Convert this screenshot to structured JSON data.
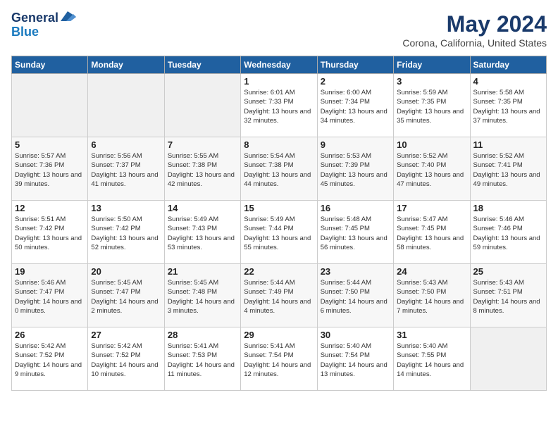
{
  "header": {
    "logo_line1": "General",
    "logo_line2": "Blue",
    "title": "May 2024",
    "subtitle": "Corona, California, United States"
  },
  "days_of_week": [
    "Sunday",
    "Monday",
    "Tuesday",
    "Wednesday",
    "Thursday",
    "Friday",
    "Saturday"
  ],
  "weeks": [
    [
      {
        "day": "",
        "empty": true
      },
      {
        "day": "",
        "empty": true
      },
      {
        "day": "",
        "empty": true
      },
      {
        "day": "1",
        "sunrise": "Sunrise: 6:01 AM",
        "sunset": "Sunset: 7:33 PM",
        "daylight": "Daylight: 13 hours and 32 minutes."
      },
      {
        "day": "2",
        "sunrise": "Sunrise: 6:00 AM",
        "sunset": "Sunset: 7:34 PM",
        "daylight": "Daylight: 13 hours and 34 minutes."
      },
      {
        "day": "3",
        "sunrise": "Sunrise: 5:59 AM",
        "sunset": "Sunset: 7:35 PM",
        "daylight": "Daylight: 13 hours and 35 minutes."
      },
      {
        "day": "4",
        "sunrise": "Sunrise: 5:58 AM",
        "sunset": "Sunset: 7:35 PM",
        "daylight": "Daylight: 13 hours and 37 minutes."
      }
    ],
    [
      {
        "day": "5",
        "sunrise": "Sunrise: 5:57 AM",
        "sunset": "Sunset: 7:36 PM",
        "daylight": "Daylight: 13 hours and 39 minutes."
      },
      {
        "day": "6",
        "sunrise": "Sunrise: 5:56 AM",
        "sunset": "Sunset: 7:37 PM",
        "daylight": "Daylight: 13 hours and 41 minutes."
      },
      {
        "day": "7",
        "sunrise": "Sunrise: 5:55 AM",
        "sunset": "Sunset: 7:38 PM",
        "daylight": "Daylight: 13 hours and 42 minutes."
      },
      {
        "day": "8",
        "sunrise": "Sunrise: 5:54 AM",
        "sunset": "Sunset: 7:38 PM",
        "daylight": "Daylight: 13 hours and 44 minutes."
      },
      {
        "day": "9",
        "sunrise": "Sunrise: 5:53 AM",
        "sunset": "Sunset: 7:39 PM",
        "daylight": "Daylight: 13 hours and 45 minutes."
      },
      {
        "day": "10",
        "sunrise": "Sunrise: 5:52 AM",
        "sunset": "Sunset: 7:40 PM",
        "daylight": "Daylight: 13 hours and 47 minutes."
      },
      {
        "day": "11",
        "sunrise": "Sunrise: 5:52 AM",
        "sunset": "Sunset: 7:41 PM",
        "daylight": "Daylight: 13 hours and 49 minutes."
      }
    ],
    [
      {
        "day": "12",
        "sunrise": "Sunrise: 5:51 AM",
        "sunset": "Sunset: 7:42 PM",
        "daylight": "Daylight: 13 hours and 50 minutes."
      },
      {
        "day": "13",
        "sunrise": "Sunrise: 5:50 AM",
        "sunset": "Sunset: 7:42 PM",
        "daylight": "Daylight: 13 hours and 52 minutes."
      },
      {
        "day": "14",
        "sunrise": "Sunrise: 5:49 AM",
        "sunset": "Sunset: 7:43 PM",
        "daylight": "Daylight: 13 hours and 53 minutes."
      },
      {
        "day": "15",
        "sunrise": "Sunrise: 5:49 AM",
        "sunset": "Sunset: 7:44 PM",
        "daylight": "Daylight: 13 hours and 55 minutes."
      },
      {
        "day": "16",
        "sunrise": "Sunrise: 5:48 AM",
        "sunset": "Sunset: 7:45 PM",
        "daylight": "Daylight: 13 hours and 56 minutes."
      },
      {
        "day": "17",
        "sunrise": "Sunrise: 5:47 AM",
        "sunset": "Sunset: 7:45 PM",
        "daylight": "Daylight: 13 hours and 58 minutes."
      },
      {
        "day": "18",
        "sunrise": "Sunrise: 5:46 AM",
        "sunset": "Sunset: 7:46 PM",
        "daylight": "Daylight: 13 hours and 59 minutes."
      }
    ],
    [
      {
        "day": "19",
        "sunrise": "Sunrise: 5:46 AM",
        "sunset": "Sunset: 7:47 PM",
        "daylight": "Daylight: 14 hours and 0 minutes."
      },
      {
        "day": "20",
        "sunrise": "Sunrise: 5:45 AM",
        "sunset": "Sunset: 7:47 PM",
        "daylight": "Daylight: 14 hours and 2 minutes."
      },
      {
        "day": "21",
        "sunrise": "Sunrise: 5:45 AM",
        "sunset": "Sunset: 7:48 PM",
        "daylight": "Daylight: 14 hours and 3 minutes."
      },
      {
        "day": "22",
        "sunrise": "Sunrise: 5:44 AM",
        "sunset": "Sunset: 7:49 PM",
        "daylight": "Daylight: 14 hours and 4 minutes."
      },
      {
        "day": "23",
        "sunrise": "Sunrise: 5:44 AM",
        "sunset": "Sunset: 7:50 PM",
        "daylight": "Daylight: 14 hours and 6 minutes."
      },
      {
        "day": "24",
        "sunrise": "Sunrise: 5:43 AM",
        "sunset": "Sunset: 7:50 PM",
        "daylight": "Daylight: 14 hours and 7 minutes."
      },
      {
        "day": "25",
        "sunrise": "Sunrise: 5:43 AM",
        "sunset": "Sunset: 7:51 PM",
        "daylight": "Daylight: 14 hours and 8 minutes."
      }
    ],
    [
      {
        "day": "26",
        "sunrise": "Sunrise: 5:42 AM",
        "sunset": "Sunset: 7:52 PM",
        "daylight": "Daylight: 14 hours and 9 minutes."
      },
      {
        "day": "27",
        "sunrise": "Sunrise: 5:42 AM",
        "sunset": "Sunset: 7:52 PM",
        "daylight": "Daylight: 14 hours and 10 minutes."
      },
      {
        "day": "28",
        "sunrise": "Sunrise: 5:41 AM",
        "sunset": "Sunset: 7:53 PM",
        "daylight": "Daylight: 14 hours and 11 minutes."
      },
      {
        "day": "29",
        "sunrise": "Sunrise: 5:41 AM",
        "sunset": "Sunset: 7:54 PM",
        "daylight": "Daylight: 14 hours and 12 minutes."
      },
      {
        "day": "30",
        "sunrise": "Sunrise: 5:40 AM",
        "sunset": "Sunset: 7:54 PM",
        "daylight": "Daylight: 14 hours and 13 minutes."
      },
      {
        "day": "31",
        "sunrise": "Sunrise: 5:40 AM",
        "sunset": "Sunset: 7:55 PM",
        "daylight": "Daylight: 14 hours and 14 minutes."
      },
      {
        "day": "",
        "empty": true
      }
    ]
  ]
}
